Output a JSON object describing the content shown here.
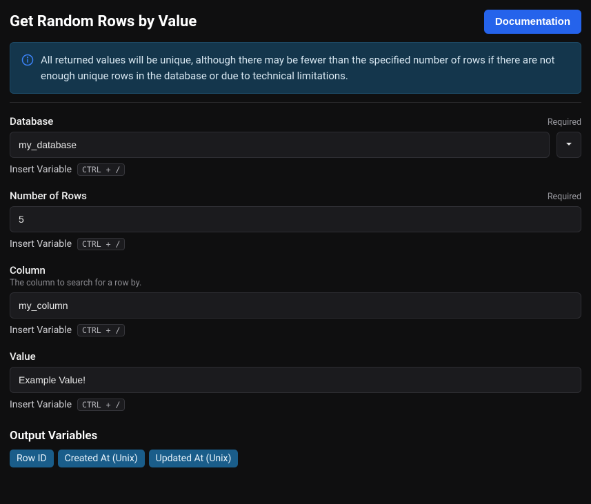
{
  "header": {
    "title": "Get Random Rows by Value",
    "doc_button": "Documentation"
  },
  "info_banner": "All returned values will be unique, although there may be fewer than the specified number of rows if there are not enough unique rows in the database or due to technical limitations.",
  "insert_variable_label": "Insert Variable",
  "insert_variable_shortcut": "CTRL + /",
  "required_label": "Required",
  "fields": {
    "database": {
      "label": "Database",
      "value": "my_database",
      "required": true
    },
    "rows": {
      "label": "Number of Rows",
      "value": "5",
      "required": true
    },
    "column": {
      "label": "Column",
      "description": "The column to search for a row by.",
      "value": "my_column",
      "required": false
    },
    "value": {
      "label": "Value",
      "value": "Example Value!",
      "required": false
    }
  },
  "output": {
    "title": "Output Variables",
    "pills": [
      "Row ID",
      "Created At (Unix)",
      "Updated At (Unix)"
    ]
  }
}
